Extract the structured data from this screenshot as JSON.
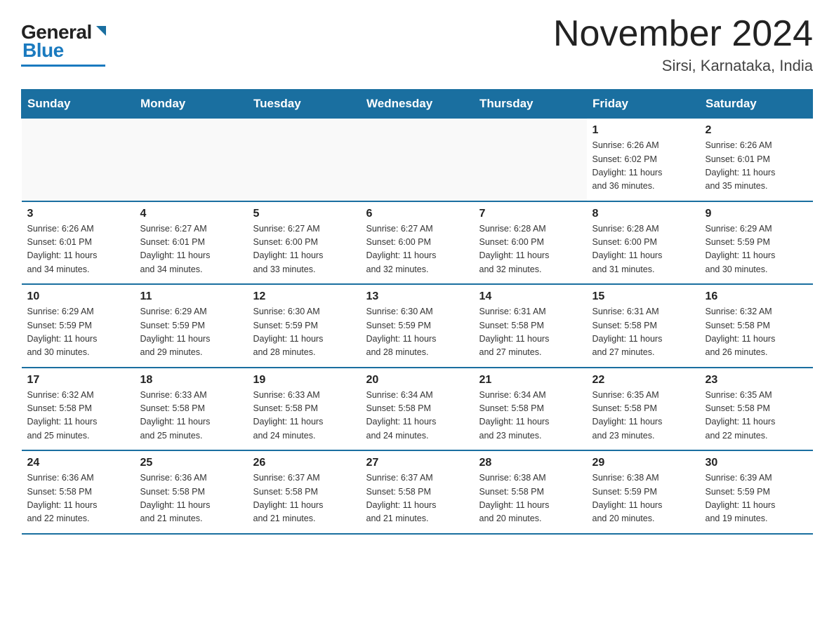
{
  "logo": {
    "general": "General",
    "blue": "Blue",
    "underline_color": "#1a7abf"
  },
  "header": {
    "month_year": "November 2024",
    "location": "Sirsi, Karnataka, India"
  },
  "weekdays": [
    "Sunday",
    "Monday",
    "Tuesday",
    "Wednesday",
    "Thursday",
    "Friday",
    "Saturday"
  ],
  "weeks": [
    [
      {
        "day": "",
        "info": ""
      },
      {
        "day": "",
        "info": ""
      },
      {
        "day": "",
        "info": ""
      },
      {
        "day": "",
        "info": ""
      },
      {
        "day": "",
        "info": ""
      },
      {
        "day": "1",
        "info": "Sunrise: 6:26 AM\nSunset: 6:02 PM\nDaylight: 11 hours\nand 36 minutes."
      },
      {
        "day": "2",
        "info": "Sunrise: 6:26 AM\nSunset: 6:01 PM\nDaylight: 11 hours\nand 35 minutes."
      }
    ],
    [
      {
        "day": "3",
        "info": "Sunrise: 6:26 AM\nSunset: 6:01 PM\nDaylight: 11 hours\nand 34 minutes."
      },
      {
        "day": "4",
        "info": "Sunrise: 6:27 AM\nSunset: 6:01 PM\nDaylight: 11 hours\nand 34 minutes."
      },
      {
        "day": "5",
        "info": "Sunrise: 6:27 AM\nSunset: 6:00 PM\nDaylight: 11 hours\nand 33 minutes."
      },
      {
        "day": "6",
        "info": "Sunrise: 6:27 AM\nSunset: 6:00 PM\nDaylight: 11 hours\nand 32 minutes."
      },
      {
        "day": "7",
        "info": "Sunrise: 6:28 AM\nSunset: 6:00 PM\nDaylight: 11 hours\nand 32 minutes."
      },
      {
        "day": "8",
        "info": "Sunrise: 6:28 AM\nSunset: 6:00 PM\nDaylight: 11 hours\nand 31 minutes."
      },
      {
        "day": "9",
        "info": "Sunrise: 6:29 AM\nSunset: 5:59 PM\nDaylight: 11 hours\nand 30 minutes."
      }
    ],
    [
      {
        "day": "10",
        "info": "Sunrise: 6:29 AM\nSunset: 5:59 PM\nDaylight: 11 hours\nand 30 minutes."
      },
      {
        "day": "11",
        "info": "Sunrise: 6:29 AM\nSunset: 5:59 PM\nDaylight: 11 hours\nand 29 minutes."
      },
      {
        "day": "12",
        "info": "Sunrise: 6:30 AM\nSunset: 5:59 PM\nDaylight: 11 hours\nand 28 minutes."
      },
      {
        "day": "13",
        "info": "Sunrise: 6:30 AM\nSunset: 5:59 PM\nDaylight: 11 hours\nand 28 minutes."
      },
      {
        "day": "14",
        "info": "Sunrise: 6:31 AM\nSunset: 5:58 PM\nDaylight: 11 hours\nand 27 minutes."
      },
      {
        "day": "15",
        "info": "Sunrise: 6:31 AM\nSunset: 5:58 PM\nDaylight: 11 hours\nand 27 minutes."
      },
      {
        "day": "16",
        "info": "Sunrise: 6:32 AM\nSunset: 5:58 PM\nDaylight: 11 hours\nand 26 minutes."
      }
    ],
    [
      {
        "day": "17",
        "info": "Sunrise: 6:32 AM\nSunset: 5:58 PM\nDaylight: 11 hours\nand 25 minutes."
      },
      {
        "day": "18",
        "info": "Sunrise: 6:33 AM\nSunset: 5:58 PM\nDaylight: 11 hours\nand 25 minutes."
      },
      {
        "day": "19",
        "info": "Sunrise: 6:33 AM\nSunset: 5:58 PM\nDaylight: 11 hours\nand 24 minutes."
      },
      {
        "day": "20",
        "info": "Sunrise: 6:34 AM\nSunset: 5:58 PM\nDaylight: 11 hours\nand 24 minutes."
      },
      {
        "day": "21",
        "info": "Sunrise: 6:34 AM\nSunset: 5:58 PM\nDaylight: 11 hours\nand 23 minutes."
      },
      {
        "day": "22",
        "info": "Sunrise: 6:35 AM\nSunset: 5:58 PM\nDaylight: 11 hours\nand 23 minutes."
      },
      {
        "day": "23",
        "info": "Sunrise: 6:35 AM\nSunset: 5:58 PM\nDaylight: 11 hours\nand 22 minutes."
      }
    ],
    [
      {
        "day": "24",
        "info": "Sunrise: 6:36 AM\nSunset: 5:58 PM\nDaylight: 11 hours\nand 22 minutes."
      },
      {
        "day": "25",
        "info": "Sunrise: 6:36 AM\nSunset: 5:58 PM\nDaylight: 11 hours\nand 21 minutes."
      },
      {
        "day": "26",
        "info": "Sunrise: 6:37 AM\nSunset: 5:58 PM\nDaylight: 11 hours\nand 21 minutes."
      },
      {
        "day": "27",
        "info": "Sunrise: 6:37 AM\nSunset: 5:58 PM\nDaylight: 11 hours\nand 21 minutes."
      },
      {
        "day": "28",
        "info": "Sunrise: 6:38 AM\nSunset: 5:58 PM\nDaylight: 11 hours\nand 20 minutes."
      },
      {
        "day": "29",
        "info": "Sunrise: 6:38 AM\nSunset: 5:59 PM\nDaylight: 11 hours\nand 20 minutes."
      },
      {
        "day": "30",
        "info": "Sunrise: 6:39 AM\nSunset: 5:59 PM\nDaylight: 11 hours\nand 19 minutes."
      }
    ]
  ]
}
